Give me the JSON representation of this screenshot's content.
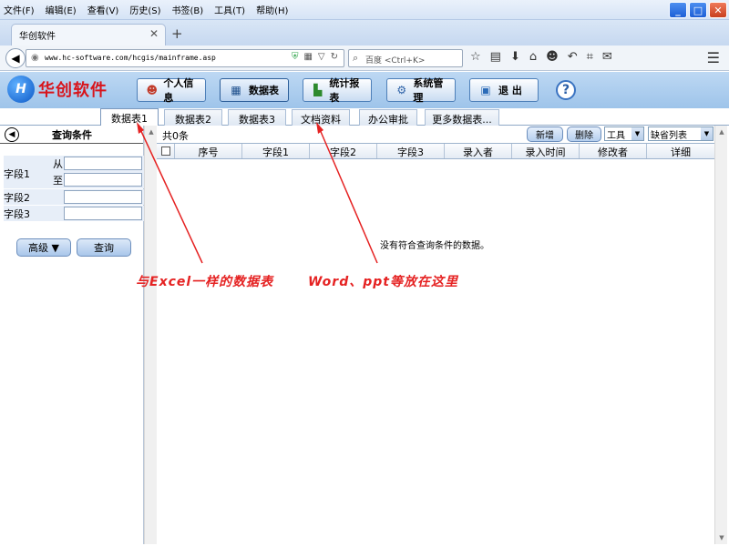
{
  "browser": {
    "menu": [
      "文件(F)",
      "编辑(E)",
      "查看(V)",
      "历史(S)",
      "书签(B)",
      "工具(T)",
      "帮助(H)"
    ],
    "tab_title": "华创软件",
    "url": "www.hc-software.com/hcgis/mainframe.asp",
    "search_placeholder": "百度 <Ctrl+K>"
  },
  "app": {
    "logo_text": "华创软件",
    "logo_mark": "H",
    "nav": {
      "personal": "个人信息",
      "data": "数据表",
      "stats": "统计报表",
      "system": "系统管理",
      "logout": "退 出"
    },
    "help": "?"
  },
  "tabs": [
    "数据表1",
    "数据表2",
    "数据表3",
    "文档资料",
    "办公审批",
    "更多数据表..."
  ],
  "query": {
    "title": "查询条件",
    "field1": "字段1",
    "from": "从",
    "to": "至",
    "field2": "字段2",
    "field3": "字段3",
    "advanced": "高级 ▼",
    "search": "查询"
  },
  "toolbar": {
    "total": "共0条",
    "add": "新增",
    "delete": "删除",
    "tools_select": "工具",
    "view_select": "缺省列表"
  },
  "grid": {
    "columns": [
      "序号",
      "字段1",
      "字段2",
      "字段3",
      "录入者",
      "录入时间",
      "修改者",
      "详细"
    ],
    "empty_message": "没有符合查询条件的数据。"
  },
  "annotations": {
    "excel": "与Excel一样的数据表",
    "docs": "Word、ppt等放在这里"
  },
  "colors": {
    "annotation": "#e52222",
    "logo_text": "#d8141b",
    "header_bg": "#9ec4ea"
  }
}
